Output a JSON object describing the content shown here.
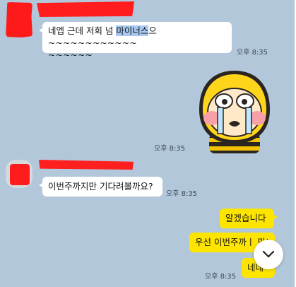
{
  "messages": [
    {
      "id": "m1",
      "direction": "incoming",
      "text_before": "네엡 근데 저희 넘 ",
      "text_highlight": "마이너스",
      "text_after": "으~~~~~~~~~~~~",
      "text_line2": "~~~~~~",
      "time": "오후 8:35"
    },
    {
      "id": "m2",
      "direction": "outgoing",
      "type": "sticker",
      "sticker_name": "crying-bee-character-sticker",
      "time": "오후 8:35"
    },
    {
      "id": "m3",
      "direction": "incoming",
      "text": "이번주까지만 기다려볼까요?",
      "time": "오후 8:35"
    },
    {
      "id": "m4",
      "direction": "outgoing",
      "text": "알겠습니다"
    },
    {
      "id": "m5",
      "direction": "outgoing",
      "text": "우선 이번주까ㅣ 만!"
    },
    {
      "id": "m6",
      "direction": "outgoing",
      "text": "네네",
      "time": "오후 8:35"
    }
  ],
  "scroll_button": {
    "icon": "chevron-down-icon"
  },
  "colors": {
    "background": "#b2c7da",
    "incoming_bubble": "#ffffff",
    "outgoing_bubble": "#fee500",
    "highlight": "#a8c8f0",
    "redaction": "#ff1a1a"
  }
}
